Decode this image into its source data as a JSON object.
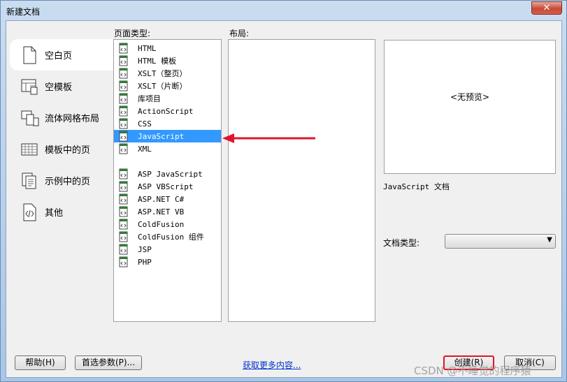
{
  "window": {
    "title": "新建文档",
    "close_glyph": "✕"
  },
  "categories": [
    {
      "label": "空白页",
      "icon": "blank-page-icon",
      "selected": true
    },
    {
      "label": "空模板",
      "icon": "blank-template-icon"
    },
    {
      "label": "流体网格布局",
      "icon": "fluid-grid-icon"
    },
    {
      "label": "模板中的页",
      "icon": "page-from-template-icon"
    },
    {
      "label": "示例中的页",
      "icon": "page-from-sample-icon"
    },
    {
      "label": "其他",
      "icon": "other-icon"
    }
  ],
  "page_type": {
    "label": "页面类型:",
    "items": [
      "HTML",
      "HTML 模板",
      "XSLT（整页）",
      "XSLT（片断）",
      "库项目",
      "ActionScript",
      "CSS",
      "JavaScript",
      "XML",
      "",
      "ASP JavaScript",
      "ASP VBScript",
      "ASP.NET C#",
      "ASP.NET VB",
      "ColdFusion",
      "ColdFusion 组件",
      "JSP",
      "PHP"
    ],
    "selected": "JavaScript"
  },
  "layout": {
    "label": "布局:"
  },
  "preview": {
    "text": "<无预览>"
  },
  "description": "JavaScript 文档",
  "doctype": {
    "label": "文档类型:",
    "value": ""
  },
  "buttons": {
    "help": "帮助(H)",
    "preferences": "首选参数(P)...",
    "more": "获取更多内容...",
    "create": "创建(R)",
    "cancel": "取消(C)"
  },
  "watermark": "CSDN @不睡觉的程序猿",
  "colors": {
    "selection": "#3399ff",
    "arrow": "#e0142c",
    "highlight_border": "#e0142c"
  }
}
